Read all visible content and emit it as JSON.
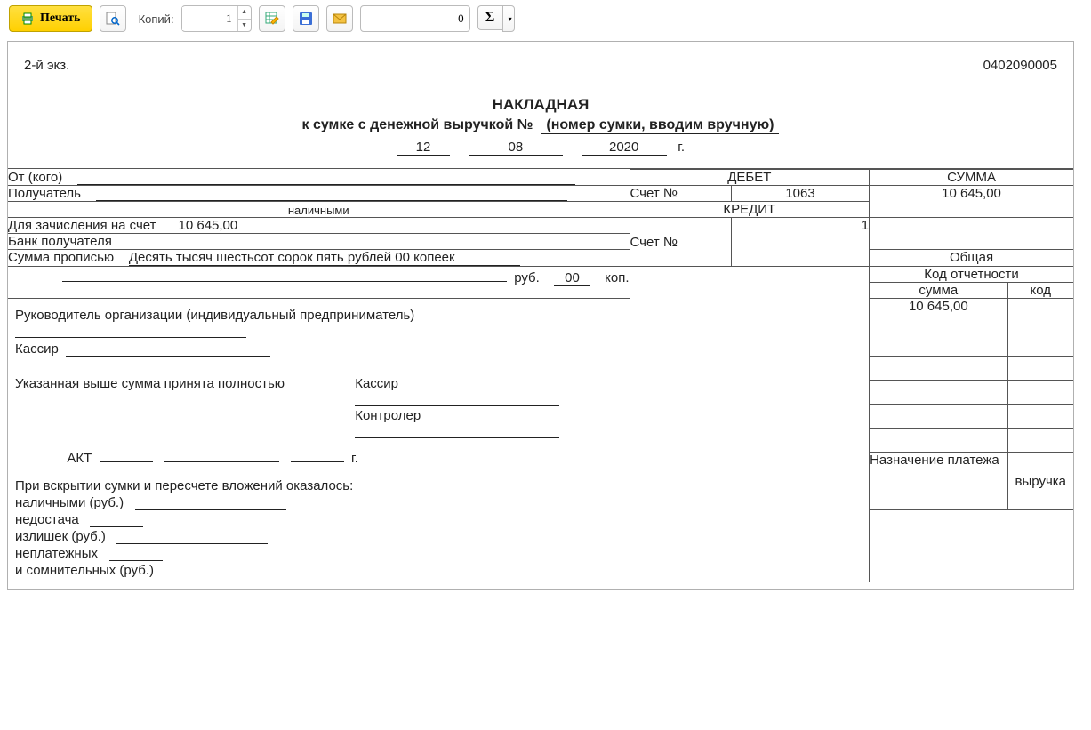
{
  "toolbar": {
    "print": "Печать",
    "copies_label": "Копий:",
    "copies": "1",
    "num": "0"
  },
  "doc": {
    "okud": "0402090005",
    "copy": "2-й экз.",
    "title": "НАКЛАДНАЯ",
    "subtitle_prefix": "к сумке с денежной выручкой №",
    "bag_no": "(номер сумки, вводим вручную)",
    "date": {
      "d": "12",
      "m": "08",
      "y": "2020",
      "suf": "г."
    },
    "from_label": "От (кого)",
    "recipient_label": "Получатель",
    "cash_caption": "наличными",
    "credit_to_label": "Для зачисления на счет",
    "credit_to_sum": "10 645,00",
    "bank_label": "Банк получателя",
    "sum_words_label": "Сумма прописью",
    "sum_words": "Десять тысяч шестьсот сорок пять рублей 00 копеек",
    "rub": "руб.",
    "kop_val": "00",
    "kop": "коп.",
    "debet": "ДЕБЕТ",
    "credit": "КРЕДИТ",
    "acct_lbl": "Счет №",
    "acct1": "1063",
    "credit_mark": "1",
    "summa": "СУММА",
    "summa_val": "10 645,00",
    "obsh": "Общая",
    "kod_ot": "Код отчетности",
    "sum_h": "сумма",
    "kod_h": "код",
    "total": "10 645,00",
    "naz": "Назначение платежа",
    "vyr": "выручка",
    "ruk": "Руководитель организации (индивидуальный предприниматель)",
    "kassir": "Кассир",
    "kontroler": "Контролер",
    "accepted": "Указанная выше сумма принята полностью",
    "akt": "АКТ",
    "akt_suf": "г.",
    "opening": "При вскрытии сумки и пересчете вложений оказалось:",
    "cash_rub": "наличными (руб.)",
    "shortage": "недостача",
    "surplus": "излишек (руб.)",
    "nonpay": "неплатежных",
    "doubt": "и сомнительных (руб.)"
  }
}
